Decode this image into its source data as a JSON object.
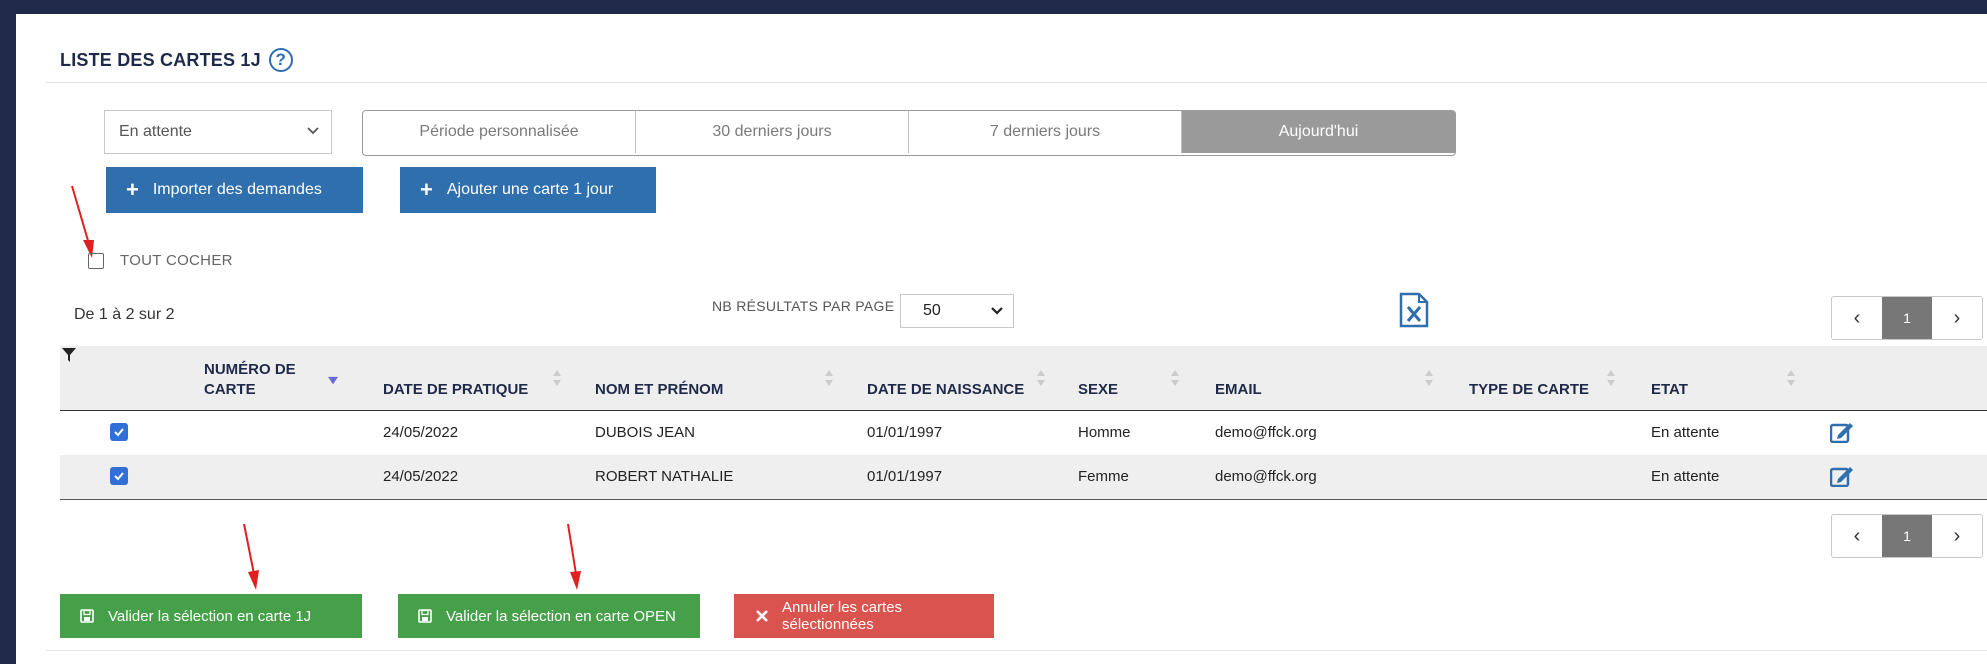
{
  "header": {
    "title": "LISTE DES CARTES 1J",
    "help_icon": "?"
  },
  "filters": {
    "status_value": "En attente",
    "periods": [
      "Période personnalisée",
      "30 derniers jours",
      "7 derniers jours",
      "Aujourd'hui"
    ],
    "active_period": "Aujourd'hui"
  },
  "actions": {
    "import_label": "Importer des demandes",
    "add_label": "Ajouter une carte 1 jour"
  },
  "select_all_label": "TOUT COCHER",
  "results": {
    "count_text": "De 1 à 2 sur 2",
    "per_page_label": "NB RÉSULTATS PAR PAGE",
    "per_page_value": "50"
  },
  "pagination": {
    "current_page": "1",
    "prev": "‹",
    "next": "›"
  },
  "table": {
    "headers": {
      "card_number": "NUMÉRO DE CARTE",
      "practice_date": "DATE DE PRATIQUE",
      "name": "NOM ET PRÉNOM",
      "birth_date": "DATE DE NAISSANCE",
      "sex": "SEXE",
      "email": "EMAIL",
      "card_type": "TYPE DE CARTE",
      "state": "ETAT"
    },
    "rows": [
      {
        "checked": true,
        "card_number": "",
        "practice_date": "24/05/2022",
        "name": "DUBOIS JEAN",
        "birth_date": "01/01/1997",
        "sex": "Homme",
        "email": "demo@ffck.org",
        "card_type": "",
        "state": "En attente"
      },
      {
        "checked": true,
        "card_number": "",
        "practice_date": "24/05/2022",
        "name": "ROBERT NATHALIE",
        "birth_date": "01/01/1997",
        "sex": "Femme",
        "email": "demo@ffck.org",
        "card_type": "",
        "state": "En attente"
      }
    ]
  },
  "bottom_actions": {
    "validate_1j": "Valider la sélection en carte 1J",
    "validate_open": "Valider la sélection en carte OPEN",
    "cancel": "Annuler les cartes sélectionnées"
  },
  "colors": {
    "primary": "#2f6fae",
    "success": "#46a049",
    "danger": "#d9534f",
    "annotation": "#e02020"
  }
}
